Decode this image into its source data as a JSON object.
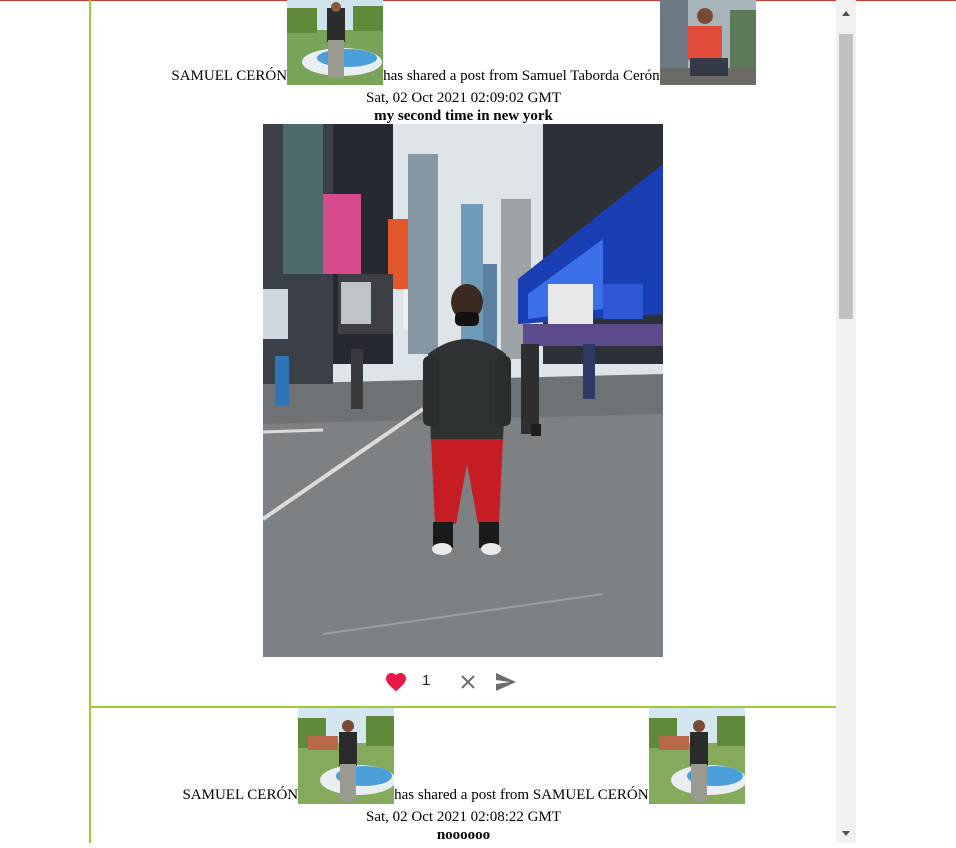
{
  "posts": [
    {
      "author": "SAMUEL CERÓN",
      "shared_text": "has shared a post from Samuel Taborda Cerón",
      "date": "Sat, 02 Oct 2021 02:09:02 GMT",
      "caption": "my second time in new york",
      "likes": "1",
      "liked": true
    },
    {
      "author": "SAMUEL CERÓN",
      "shared_text": "has shared a post from SAMUEL CERÓN",
      "date": "Sat, 02 Oct 2021 02:08:22 GMT",
      "caption": "noooooo"
    }
  ],
  "icons": {
    "like": "heart-icon",
    "remove": "close-icon",
    "share": "send-icon",
    "scroll_up": "chevron-up-icon",
    "scroll_down": "chevron-down-icon"
  },
  "colors": {
    "border": "#9acd32",
    "heart": "#e8194a",
    "top_line": "#cc3b30"
  }
}
